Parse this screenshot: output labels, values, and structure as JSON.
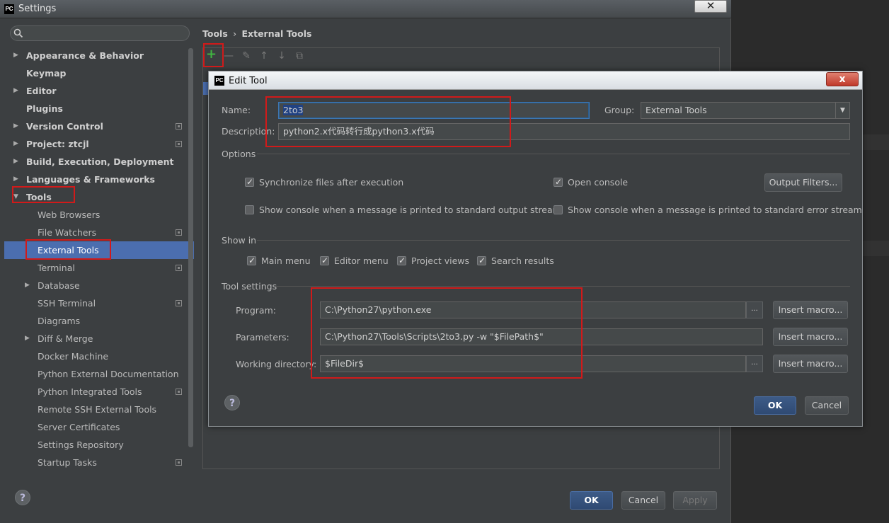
{
  "window": {
    "title": "Settings",
    "logo": "PC"
  },
  "search": {
    "placeholder": ""
  },
  "tree": [
    {
      "label": "Appearance & Behavior",
      "level": 0,
      "arrow": "▶",
      "bold": true
    },
    {
      "label": "Keymap",
      "level": 0,
      "bold": true
    },
    {
      "label": "Editor",
      "level": 0,
      "arrow": "▶",
      "bold": true
    },
    {
      "label": "Plugins",
      "level": 0,
      "bold": true
    },
    {
      "label": "Version Control",
      "level": 0,
      "arrow": "▶",
      "bold": true,
      "proj": true
    },
    {
      "label": "Project: ztcjl",
      "level": 0,
      "arrow": "▶",
      "bold": true,
      "proj": true
    },
    {
      "label": "Build, Execution, Deployment",
      "level": 0,
      "arrow": "▶",
      "bold": true
    },
    {
      "label": "Languages & Frameworks",
      "level": 0,
      "arrow": "▶",
      "bold": true
    },
    {
      "label": "Tools",
      "level": 0,
      "arrow": "▼",
      "bold": true
    },
    {
      "label": "Web Browsers",
      "level": 1
    },
    {
      "label": "File Watchers",
      "level": 1,
      "proj": true
    },
    {
      "label": "External Tools",
      "level": 1,
      "selected": true
    },
    {
      "label": "Terminal",
      "level": 1,
      "proj": true
    },
    {
      "label": "Database",
      "level": 1,
      "arrow": "▶"
    },
    {
      "label": "SSH Terminal",
      "level": 1,
      "proj": true
    },
    {
      "label": "Diagrams",
      "level": 1
    },
    {
      "label": "Diff & Merge",
      "level": 1,
      "arrow": "▶"
    },
    {
      "label": "Docker Machine",
      "level": 1
    },
    {
      "label": "Python External Documentation",
      "level": 1
    },
    {
      "label": "Python Integrated Tools",
      "level": 1,
      "proj": true
    },
    {
      "label": "Remote SSH External Tools",
      "level": 1
    },
    {
      "label": "Server Certificates",
      "level": 1
    },
    {
      "label": "Settings Repository",
      "level": 1
    },
    {
      "label": "Startup Tasks",
      "level": 1,
      "proj": true
    }
  ],
  "breadcrumb": {
    "parent": "Tools",
    "sep": "›",
    "current": "External Tools"
  },
  "toolbar": {
    "add": "+",
    "remove": "—",
    "edit": "✎",
    "up": "↑",
    "down": "↓",
    "copy": "⧉"
  },
  "footer": {
    "ok": "OK",
    "cancel": "Cancel",
    "apply": "Apply",
    "help": "?"
  },
  "dialog": {
    "title": "Edit Tool",
    "logo": "PC",
    "close": "x",
    "name_label": "Name:",
    "name_value": "2to3",
    "group_label": "Group:",
    "group_value": "External Tools",
    "desc_label": "Description:",
    "desc_value": "python2.x代码转行成python3.x代码",
    "options_header": "Options",
    "opt_sync": "Synchronize files after execution",
    "opt_console": "Open console",
    "opt_output_filters": "Output Filters...",
    "opt_stdout": "Show console when a message is printed to standard output stream",
    "opt_stderr": "Show console when a message is printed to standard error stream",
    "showin_header": "Show in",
    "show_main": "Main menu",
    "show_editor": "Editor menu",
    "show_project": "Project views",
    "show_search": "Search results",
    "toolsettings_header": "Tool settings",
    "program_label": "Program:",
    "program_value": "C:\\Python27\\python.exe",
    "params_label": "Parameters:",
    "params_value": "C:\\Python27\\Tools\\Scripts\\2to3.py -w \"$FilePath$\"",
    "workdir_label": "Working directory:",
    "workdir_value": "$FileDir$",
    "browse": "...",
    "insert_macro": "Insert macro...",
    "ok": "OK",
    "cancel": "Cancel",
    "help": "?"
  },
  "checks": {
    "sync": true,
    "console": true,
    "stdout": false,
    "stderr": false,
    "main": true,
    "editor": true,
    "project": true,
    "search": true
  }
}
